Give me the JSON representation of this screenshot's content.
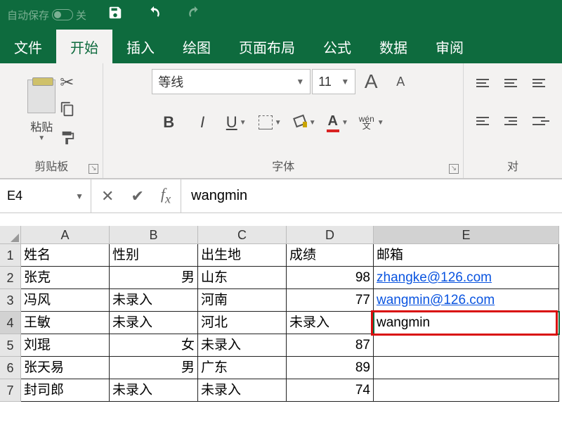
{
  "qat": {
    "autosave_label": "自动保存",
    "autosave_state": "关"
  },
  "tabs": [
    "文件",
    "开始",
    "插入",
    "绘图",
    "页面布局",
    "公式",
    "数据",
    "审阅"
  ],
  "active_tab": 1,
  "ribbon": {
    "clipboard": {
      "paste": "粘贴",
      "group": "剪贴板"
    },
    "font": {
      "name": "等线",
      "size": "11",
      "group": "字体",
      "phonetic": "wén"
    },
    "alignment": {
      "group": "对"
    }
  },
  "namebox": "E4",
  "formula": "wangmin",
  "columns": [
    "A",
    "B",
    "C",
    "D",
    "E"
  ],
  "rows": [
    {
      "n": "1",
      "c": [
        "姓名",
        "性别",
        "出生地",
        "成绩",
        "邮箱"
      ]
    },
    {
      "n": "2",
      "c": [
        "张克",
        "男",
        "山东",
        "98",
        "zhangke@126.com"
      ]
    },
    {
      "n": "3",
      "c": [
        "冯风",
        "未录入",
        "河南",
        "77",
        "wangmin@126.com"
      ]
    },
    {
      "n": "4",
      "c": [
        "王敏",
        "未录入",
        "河北",
        "未录入",
        "wangmin"
      ]
    },
    {
      "n": "5",
      "c": [
        "刘琨",
        "女",
        "未录入",
        "87",
        ""
      ]
    },
    {
      "n": "6",
      "c": [
        "张天易",
        "男",
        "广东",
        "89",
        ""
      ]
    },
    {
      "n": "7",
      "c": [
        "封司郎",
        "未录入",
        "未录入",
        "74",
        ""
      ]
    }
  ],
  "active_cell": {
    "row": 4,
    "col": 5
  }
}
